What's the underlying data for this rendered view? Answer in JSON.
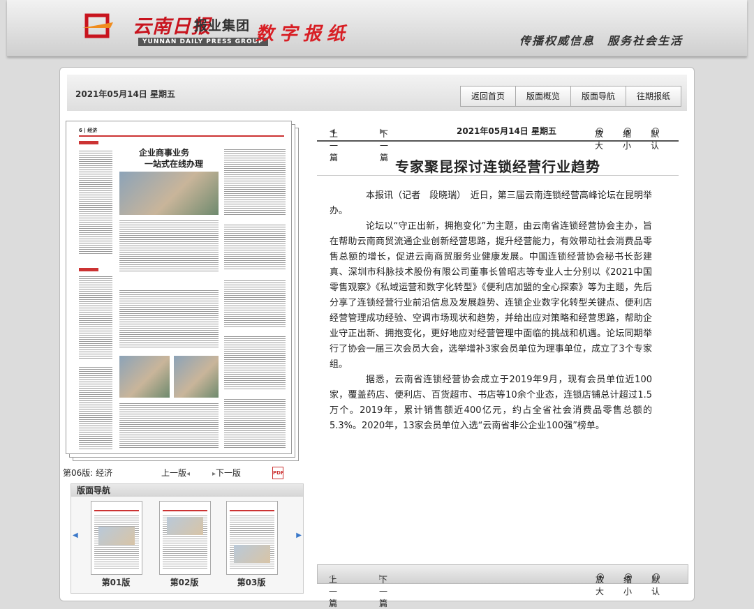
{
  "header": {
    "logo_cn": "云南日报",
    "logo_group": "报业集团",
    "logo_en": "YUNNAN DAILY PRESS GROUP",
    "product": "数字报纸",
    "slogan": "传播权威信息　服务社会生活"
  },
  "topbar": {
    "date": "2021年05月14日  星期五",
    "buttons": [
      "返回首页",
      "版面概览",
      "版面导航",
      "往期报纸"
    ]
  },
  "page_thumbnail": {
    "section_tag": "6 | 经济",
    "headline_line1": "企业商事业务",
    "headline_line2": "一站式在线办理"
  },
  "page_info": {
    "label": "第06版: 经济",
    "prev": "上一版",
    "next": "下一版"
  },
  "thumb_nav": {
    "title": "版面导航",
    "items": [
      "第01版",
      "第02版",
      "第03版"
    ]
  },
  "article_nav": {
    "prev": "上一篇",
    "next": "下一篇",
    "date": "2021年05月14日  星期五",
    "zoom_in": "放大",
    "zoom_out": "缩小",
    "default": "默认"
  },
  "article": {
    "title": "专家聚昆探讨连锁经营行业趋势",
    "paragraphs": [
      "本报讯（记者　段晓瑞）　近日，第三届云南连锁经营高峰论坛在昆明举办。",
      "论坛以“守正出新，拥抱变化”为主题，由云南省连锁经营协会主办，旨在帮助云南商贸流通企业创新经营思路，提升经营能力，有效带动社会消费品零售总额的增长，促进云南商贸服务业健康发展。中国连锁经营协会秘书长彭建真、深圳市科脉技术股份有限公司董事长曾昭志等专业人士分别以《2021中国零售观察》《私域运营和数字化转型》《便利店加盟的全心探索》等为主题，先后分享了连锁经营行业前沿信息及发展趋势、连锁企业数字化转型关键点、便利店经营管理成功经验、空调市场现状和趋势，并给出应对策略和经营思路，帮助企业守正出新、拥抱变化，更好地应对经营管理中面临的挑战和机遇。论坛同期举行了协会一届三次会员大会，选举增补3家会员单位为理事单位，成立了3个专家组。",
      "据悉，云南省连锁经营协会成立于2019年9月，现有会员单位近100家，覆盖药店、便利店、百货超市、书店等10余个业态，连锁店铺总计超过1.5万个。2019年，累计销售额近400亿元，约占全省社会消费品零售总额的5.3%。2020年，13家会员单位入选“云南省非公企业100强”榜单。"
    ]
  },
  "bottom_nav": {
    "prev": "上一篇",
    "next": "下一篇",
    "zoom_in": "放大",
    "zoom_out": "缩小",
    "default": "默认"
  }
}
